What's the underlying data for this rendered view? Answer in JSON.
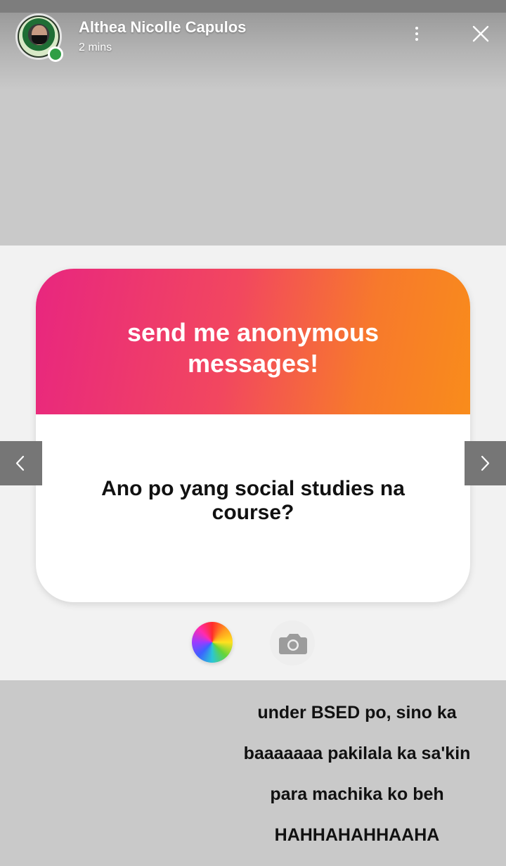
{
  "header": {
    "name": "Althea Nicolle Capulos",
    "time": "2 mins",
    "more_icon": "more-vertical-icon",
    "close_icon": "close-icon"
  },
  "card": {
    "title_line1": "send me anonymous",
    "title_line2": "messages!",
    "question_line1": "Ano po yang social studies na",
    "question_line2": "course?",
    "gradient_colors": [
      "#e8267f",
      "#f2475f",
      "#f98c1b"
    ]
  },
  "tools": {
    "color_icon": "color-wheel-icon",
    "camera_icon": "camera-icon"
  },
  "nav": {
    "prev_icon": "chevron-left-icon",
    "next_icon": "chevron-right-icon"
  },
  "reply": {
    "line1": "under BSED po, sino ka",
    "line2": "baaaaaaa pakilala ka sa'kin",
    "line3": "para machika ko beh",
    "line4": "HAHHAHAHHAAHA"
  }
}
